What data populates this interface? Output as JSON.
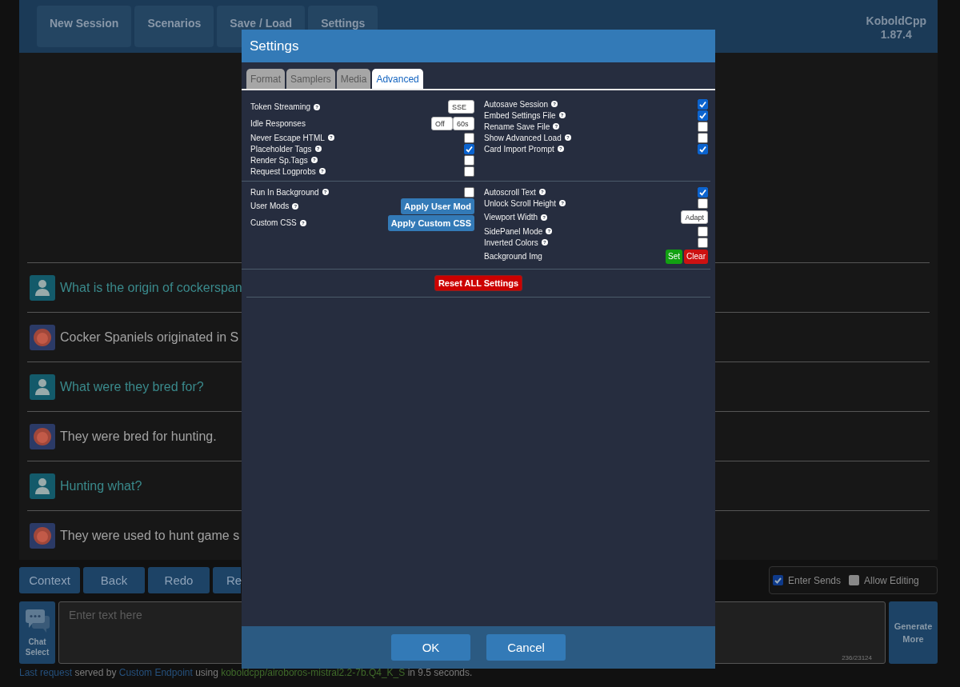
{
  "nav": {
    "buttons": [
      "New Session",
      "Scenarios",
      "Save / Load",
      "Settings"
    ],
    "brand": "KoboldCpp",
    "version": "1.87.4"
  },
  "chat": {
    "messages": [
      {
        "kind": "user",
        "text": "What is the origin of cockerspan"
      },
      {
        "kind": "bot",
        "text": "Cocker Spaniels originated in S"
      },
      {
        "kind": "user",
        "text": "What were they bred for?"
      },
      {
        "kind": "bot",
        "text": "They were bred for hunting."
      },
      {
        "kind": "user",
        "text": "Hunting what?"
      },
      {
        "kind": "bot",
        "text": "They were used to hunt game s"
      }
    ]
  },
  "actions": [
    "Context",
    "Back",
    "Redo",
    "Re"
  ],
  "options": [
    {
      "label": "Enter Sends",
      "checked": true
    },
    {
      "label": "Allow Editing",
      "checked": false
    }
  ],
  "input": {
    "chat_select": "Chat Select",
    "placeholder": "Enter text here",
    "counter": "236/23124",
    "generate": "Generate More"
  },
  "status": [
    {
      "kind": "link",
      "text": "Last request"
    },
    {
      "kind": "text",
      "text": " served by "
    },
    {
      "kind": "link",
      "text": "Custom Endpoint"
    },
    {
      "kind": "text",
      "text": " using "
    },
    {
      "kind": "model",
      "text": "koboldcpp/airoboros-mistral2.2-7b.Q4_K_S"
    },
    {
      "kind": "text",
      "text": " in 9.5 seconds."
    }
  ],
  "settings": {
    "title": "Settings",
    "tabs": [
      {
        "label": "Format",
        "selected": false
      },
      {
        "label": "Samplers",
        "selected": false
      },
      {
        "label": "Media",
        "selected": false
      },
      {
        "label": "Advanced",
        "selected": true
      }
    ],
    "sections": [
      {
        "left": [
          {
            "kind": "select",
            "label": "Token Streaming",
            "help": "?",
            "value": "SSE"
          },
          {
            "kind": "pair",
            "label": "Idle Responses",
            "values": [
              "Off",
              "60s"
            ]
          },
          {
            "kind": "toggle",
            "label": "Never Escape HTML",
            "help": "?",
            "checked": false
          },
          {
            "kind": "toggle",
            "label": "Placeholder Tags",
            "help": "?",
            "checked": true
          },
          {
            "kind": "toggle",
            "label": "Render Sp.Tags",
            "help": "?",
            "checked": false
          },
          {
            "kind": "toggle",
            "label": "Request Logprobs",
            "help": "?",
            "checked": false
          }
        ],
        "right": [
          {
            "kind": "toggle",
            "label": "Autosave Session",
            "help": "?",
            "checked": true
          },
          {
            "kind": "toggle",
            "label": "Embed Settings File",
            "help": "?",
            "checked": true
          },
          {
            "kind": "toggle",
            "label": "Rename Save File",
            "help": "?",
            "checked": false
          },
          {
            "kind": "toggle",
            "label": "Show Advanced Load",
            "help": "?",
            "checked": false
          },
          {
            "kind": "toggle",
            "label": "Card Import Prompt",
            "help": "?",
            "checked": true
          }
        ]
      },
      {
        "left": [
          {
            "kind": "toggle",
            "label": "Run In Background",
            "help": "?",
            "checked": false
          },
          {
            "kind": "button",
            "label": "User Mods",
            "help": "?",
            "button": "Apply User Mod"
          },
          {
            "kind": "button",
            "label": "Custom CSS",
            "help": "?",
            "button": "Apply Custom CSS"
          }
        ],
        "right": [
          {
            "kind": "toggle",
            "label": "Autoscroll Text",
            "help": "?",
            "checked": true
          },
          {
            "kind": "toggle",
            "label": "Unlock Scroll Height",
            "help": "?",
            "checked": false
          },
          {
            "kind": "select",
            "label": "Viewport Width",
            "help": "?",
            "value": "Adapt"
          },
          {
            "kind": "toggle",
            "label": "SidePanel Mode",
            "help": "?",
            "checked": false
          },
          {
            "kind": "toggle",
            "label": "Inverted Colors",
            "help": "?",
            "checked": false
          },
          {
            "kind": "buttons",
            "label": "Background Img",
            "buttons": [
              {
                "text": "Set",
                "color": "#12a012"
              },
              {
                "text": "Clear",
                "color": "#cc1111"
              }
            ]
          }
        ]
      }
    ],
    "reset": "Reset ALL Settings",
    "buttons": [
      "OK",
      "Cancel"
    ]
  }
}
